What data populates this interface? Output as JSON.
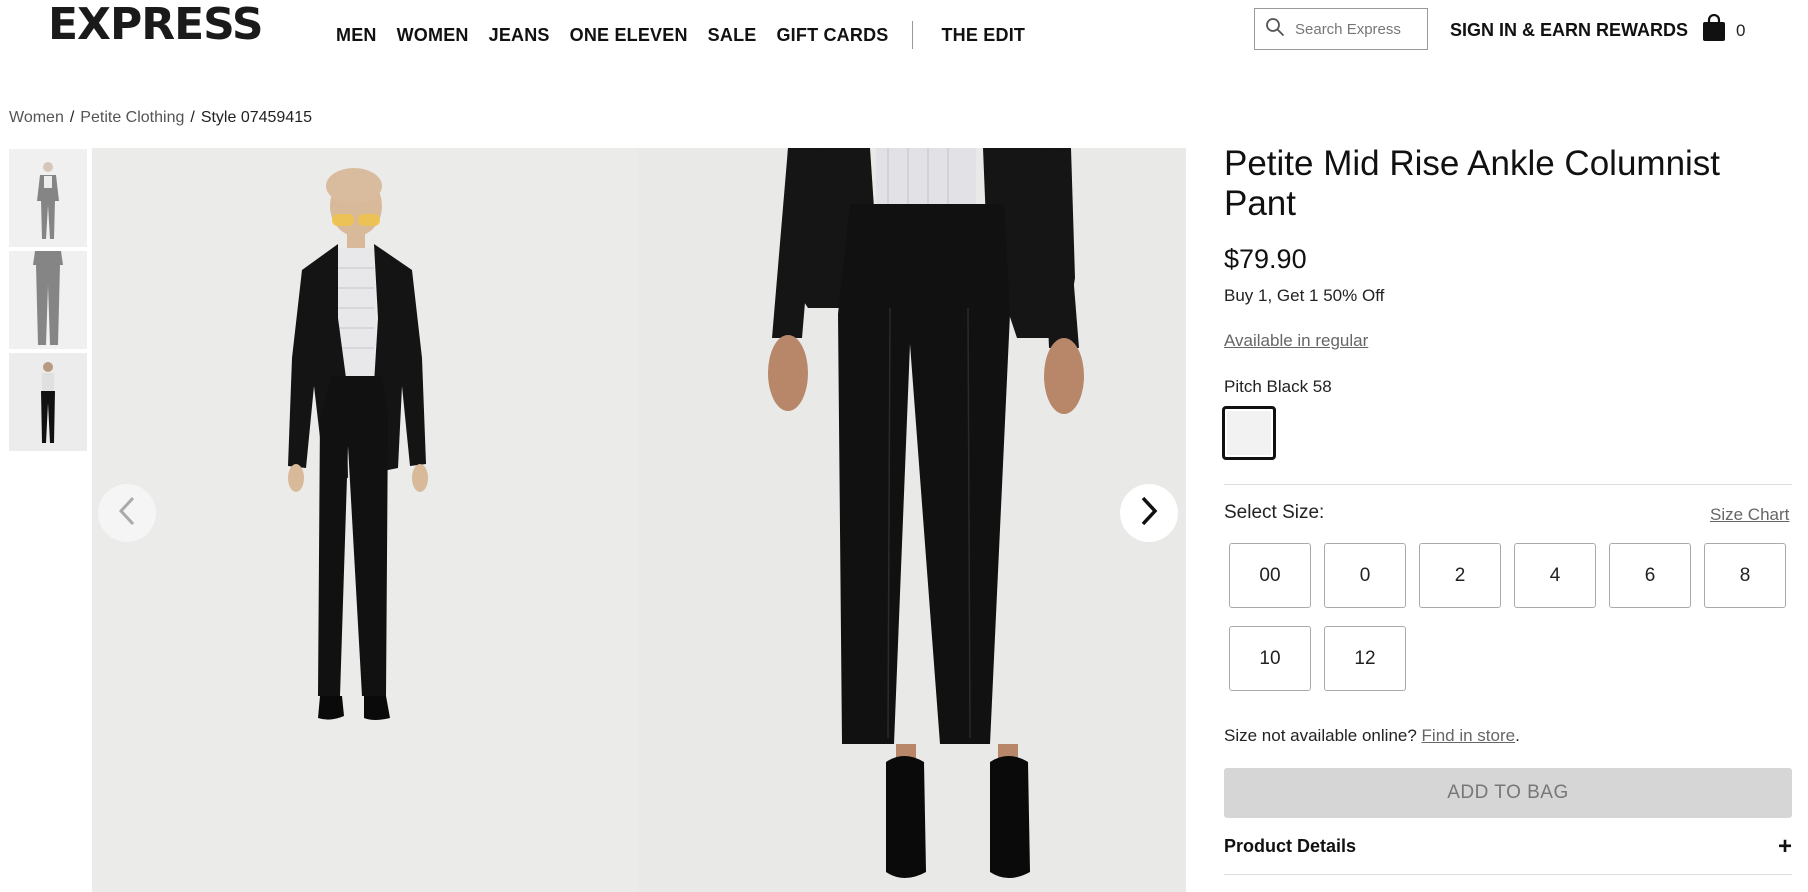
{
  "header": {
    "logo": "EXPRESS",
    "nav": [
      "MEN",
      "WOMEN",
      "JEANS",
      "ONE ELEVEN",
      "SALE",
      "GIFT CARDS"
    ],
    "nav_edit": "THE EDIT",
    "search_placeholder": "Search Express",
    "signin": "SIGN IN & EARN REWARDS",
    "bag_count": "0"
  },
  "breadcrumb": {
    "level1": "Women",
    "level2": "Petite Clothing",
    "current": "Style 07459415",
    "separator": "/"
  },
  "product": {
    "title": "Petite Mid Rise Ankle Columnist Pant",
    "price": "$79.90",
    "promo": "Buy 1, Get 1 50% Off",
    "available_link": "Available in regular",
    "color_name": "Pitch Black 58",
    "select_size_label": "Select Size:",
    "size_chart": "Size Chart",
    "sizes": [
      "00",
      "0",
      "2",
      "4",
      "6",
      "8",
      "10",
      "12"
    ],
    "not_available_text": "Size not available online?",
    "find_in_store": "Find in store",
    "period": ".",
    "add_to_bag": "ADD TO BAG",
    "details_label": "Product Details",
    "details_toggle": "+"
  },
  "colors": {
    "add_to_bag_bg": "#d6d6d6",
    "text": "#111111",
    "link_gray": "#666666"
  }
}
